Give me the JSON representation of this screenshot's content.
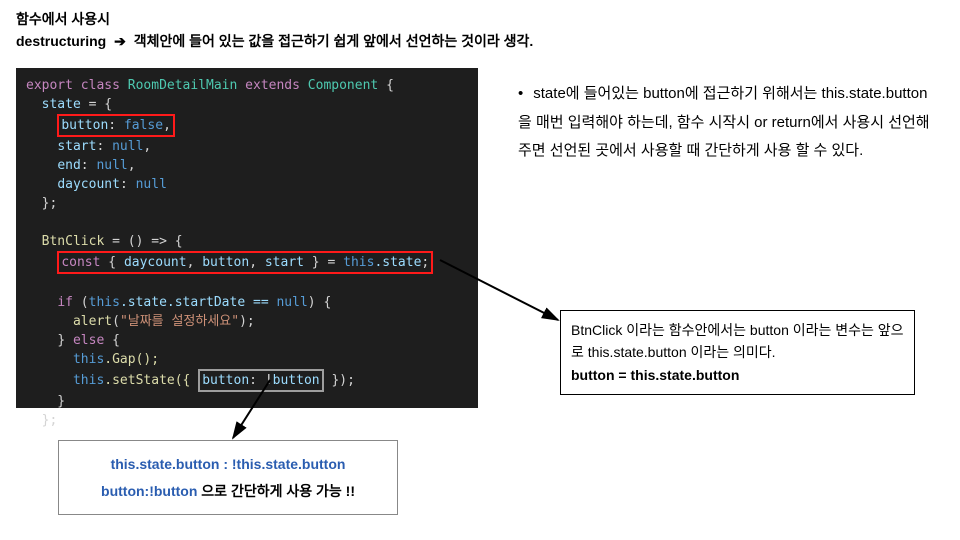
{
  "heading": {
    "line1": "함수에서 사용시",
    "line2a": "destructuring",
    "arrow": "➔",
    "line2b": "객체안에 들어 있는 값을 접근하기 쉽게 앞에서 선언하는 것이라 생각."
  },
  "code": {
    "l1_export": "export",
    "l1_class": "class",
    "l1_name": "RoomDetailMain",
    "l1_extends": "extends",
    "l1_comp": "Component",
    "l1_brace": " {",
    "l2_state": "state",
    "l2_eq": " = {",
    "l3_key": "button",
    "l3_colon": ":",
    "l3_val": "false",
    "l3_comma": ",",
    "l4_key": "start",
    "l4_colon": ":",
    "l4_val": "null",
    "l4_comma": ",",
    "l5_key": "end",
    "l5_colon": ":",
    "l5_val": "null",
    "l5_comma": ",",
    "l6_key": "daycount",
    "l6_colon": ":",
    "l6_val": "null",
    "l7": "  };",
    "l9_fn": "BtnClick",
    "l9_rest": " = () => {",
    "l10_const": "const",
    "l10_open": " { ",
    "l10_a": "daycount",
    "l10_c1": ", ",
    "l10_b": "button",
    "l10_c2": ", ",
    "l10_c": "start",
    "l10_close": " } = ",
    "l10_this": "this",
    "l10_state": ".state",
    "l10_semi": ";",
    "l12_if": "if",
    "l12_open": " (",
    "l12_this": "this",
    "l12_dot": ".state.startDate == ",
    "l12_null": "null",
    "l12_close": ") {",
    "l13_fn": "alert",
    "l13_open": "(",
    "l13_str": "\"날짜를 설정하세요\"",
    "l13_close": ");",
    "l14_else_close": "} ",
    "l14_else": "else",
    "l14_brace": " {",
    "l15_this": "this",
    "l15_gap": ".Gap();",
    "l16_this": "this",
    "l16_set": ".setState({ ",
    "l16_key": "button",
    "l16_colon": ": !",
    "l16_val": "button",
    "l16_close": " });",
    "l17": "    }",
    "l18": "  };"
  },
  "bullet": {
    "dot": "•",
    "text": "state에 들어있는 button에 접근하기 위해서는 this.state.button 을 매번 입력해야 하는데, 함수 시작시 or return에서 사용시 선언해주면 선언된 곳에서 사용할 때 간단하게 사용 할 수 있다."
  },
  "callout_right": {
    "body": "BtnClick 이라는 함수안에서는 button 이라는 변수는 앞으로 this.state.button  이라는 의미다.",
    "strong": "button = this.state.button"
  },
  "callout_bottom": {
    "line1": "this.state.button : !this.state.button",
    "line2a": "button:!button",
    "line2b": " 으로 간단하게 사용 가능 !!"
  }
}
